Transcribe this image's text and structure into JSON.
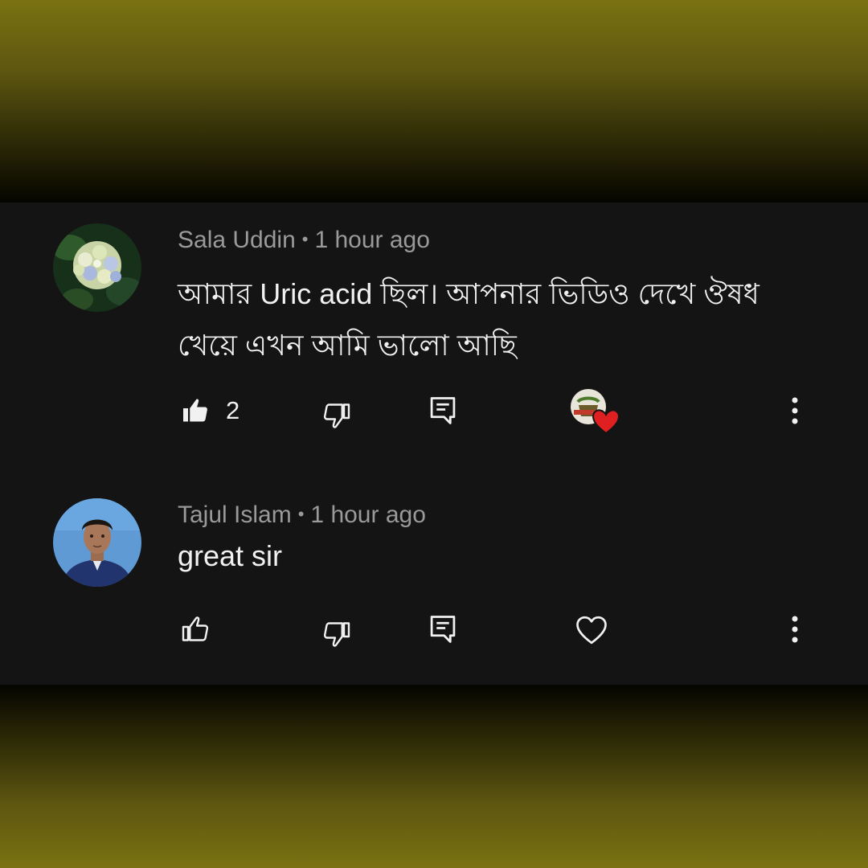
{
  "comments": [
    {
      "author": "Sala Uddin",
      "time": "1 hour ago",
      "text": "আমার Uric acid ছিল। আপনার ভিডিও দেখে ঔষধ খেয়ে এখন আমি ভালো আছি",
      "likes": "2",
      "liked": true,
      "hearted_by_creator": true,
      "avatar": "hydrangea-flower-avatar"
    },
    {
      "author": "Tajul Islam",
      "time": "1 hour ago",
      "text": "great sir",
      "likes": "",
      "liked": false,
      "hearted_by_creator": false,
      "avatar": "person-portrait-avatar"
    }
  ],
  "separator": "•",
  "colors": {
    "background_panel": "#141414",
    "outer_gradient": "#7a7211",
    "meta_text": "#9a9a9a",
    "body_text": "#f1f1f1",
    "heart": "#e02020"
  },
  "icons": [
    "thumb-up-icon",
    "thumb-down-icon",
    "reply-icon",
    "heart-icon",
    "more-vert-icon"
  ]
}
